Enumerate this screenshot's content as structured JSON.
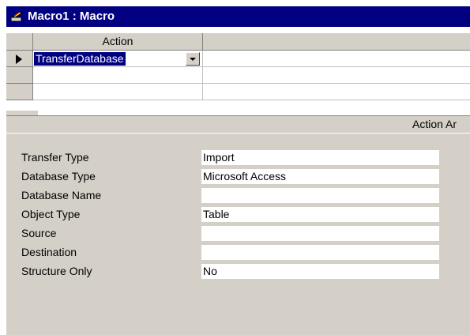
{
  "window": {
    "title": "Macro1 : Macro",
    "icon": "macro-icon"
  },
  "grid": {
    "column_action": "Action",
    "column_comment": "",
    "rows": [
      {
        "action": "TransferDatabase",
        "comment": "",
        "current": true
      },
      {
        "action": "",
        "comment": ""
      },
      {
        "action": "",
        "comment": ""
      }
    ]
  },
  "arguments": {
    "header": "Action Ar",
    "items": [
      {
        "label": "Transfer Type",
        "value": "Import"
      },
      {
        "label": "Database Type",
        "value": "Microsoft Access"
      },
      {
        "label": "Database Name",
        "value": ""
      },
      {
        "label": "Object Type",
        "value": "Table"
      },
      {
        "label": "Source",
        "value": ""
      },
      {
        "label": "Destination",
        "value": ""
      },
      {
        "label": "Structure Only",
        "value": "No"
      }
    ]
  },
  "colors": {
    "titlebar": "#000080",
    "face": "#d4d0c8",
    "selection": "#000080"
  }
}
